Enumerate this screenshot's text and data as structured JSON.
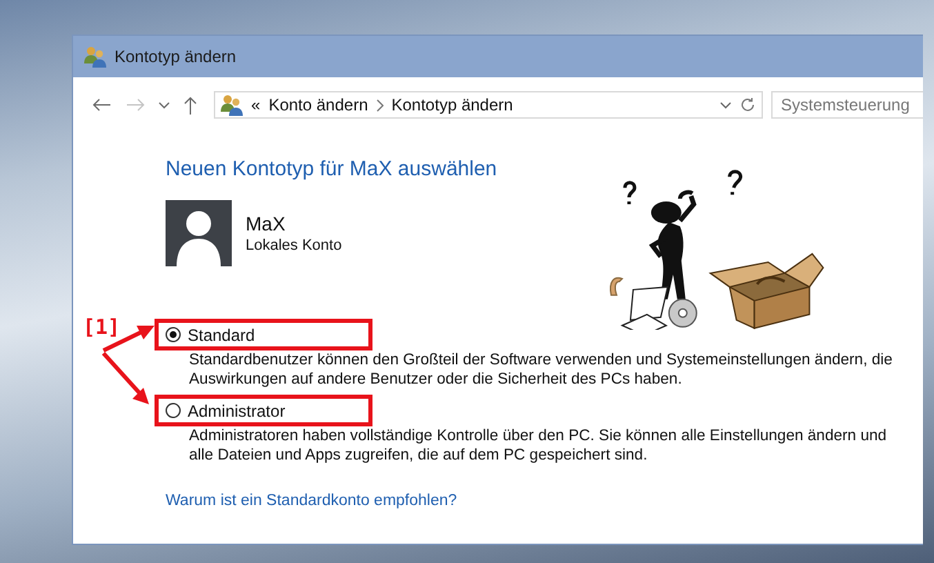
{
  "window": {
    "title": "Kontotyp ändern"
  },
  "toolbar": {
    "overflow": "«",
    "breadcrumb": [
      "Konto ändern",
      "Kontotyp ändern"
    ],
    "search": {
      "placeholder": "Systemsteuerung"
    }
  },
  "heading": "Neuen Kontotyp für MaX auswählen",
  "account": {
    "name": "MaX",
    "type": "Lokales Konto"
  },
  "options": [
    {
      "label": "Standard",
      "selected": true,
      "description": [
        "Standardbenutzer können den Großteil der Software verwenden und Systemeinstellungen ändern, die",
        "Auswirkungen auf andere Benutzer oder die Sicherheit des PCs haben."
      ]
    },
    {
      "label": "Administrator",
      "selected": false,
      "description": [
        "Administratoren haben vollständige Kontrolle über den PC. Sie können alle Einstellungen ändern und",
        "alle Dateien und Apps zugreifen, die auf dem PC gespeichert sind."
      ]
    }
  ],
  "link": "Warum ist ein Standardkonto empfohlen?",
  "annotation": {
    "label": "[1]"
  }
}
